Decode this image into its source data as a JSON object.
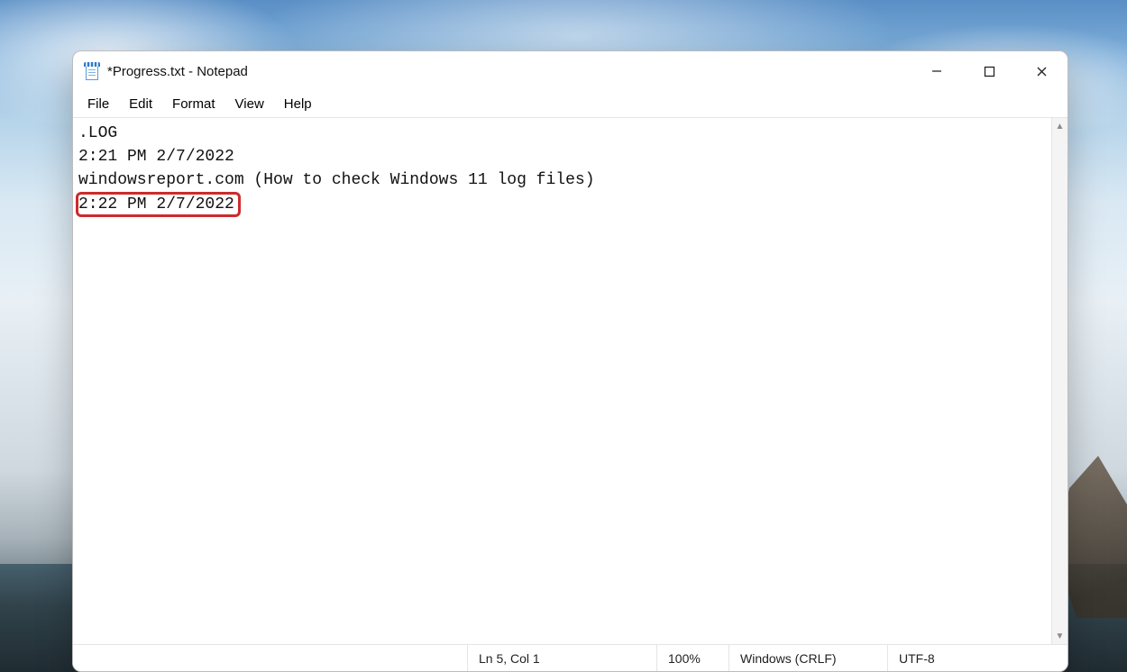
{
  "window": {
    "title": "*Progress.txt - Notepad"
  },
  "menu": {
    "file": "File",
    "edit": "Edit",
    "format": "Format",
    "view": "View",
    "help": "Help"
  },
  "content": {
    "line1": ".LOG",
    "line2": "2:21 PM 2/7/2022",
    "line3": "windowsreport.com (How to check Windows 11 log files)",
    "line4_highlighted": "2:22 PM 2/7/2022"
  },
  "status": {
    "position": "Ln 5, Col 1",
    "zoom": "100%",
    "line_ending": "Windows (CRLF)",
    "encoding": "UTF-8"
  },
  "annotation": {
    "highlight_color": "#cc2b2b"
  }
}
